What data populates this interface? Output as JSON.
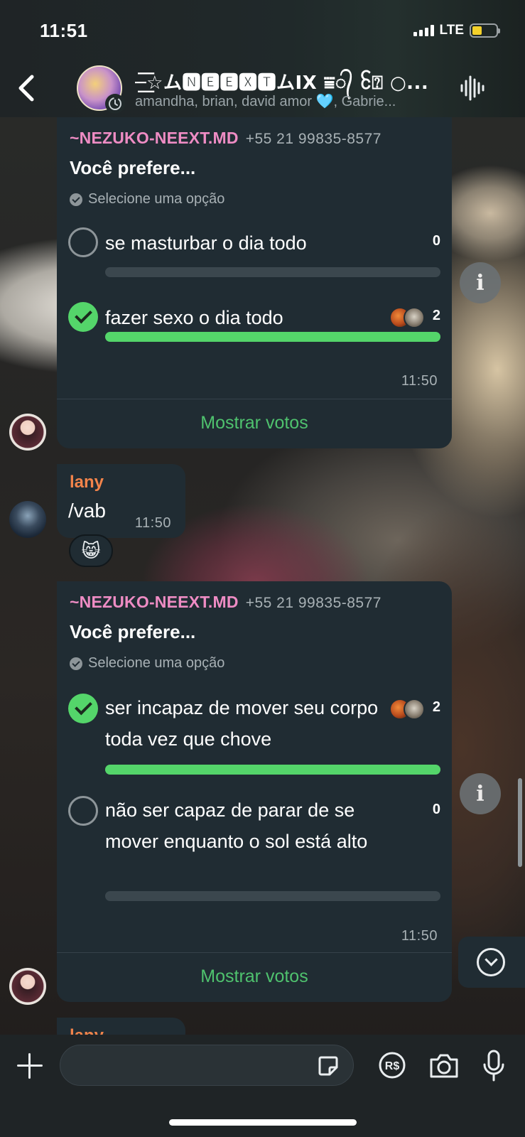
{
  "status_bar": {
    "time": "11:51",
    "network": "LTE"
  },
  "header": {
    "title": "─͟͞☆ム🅽🅴🅴🆇🆃ムIX ⩸᭄ ᩰ⍰ ○...",
    "members": "amandha, brian, david amor 🩵, Gabrie..."
  },
  "polls": [
    {
      "sender": "~NEZUKO-NEEXT.MD",
      "phone": "+55 21 99835-8577",
      "question": "Você prefere...",
      "hint": "Selecione uma opção",
      "options": [
        {
          "text": "se masturbar o dia todo",
          "count": "0",
          "progress": 0
        },
        {
          "text": "fazer sexo o dia todo",
          "count": "2",
          "progress": 1
        }
      ],
      "time": "11:50",
      "show_votes": "Mostrar votos"
    },
    {
      "sender": "~NEZUKO-NEEXT.MD",
      "phone": "+55 21 99835-8577",
      "question": "Você prefere...",
      "hint": "Selecione uma opção",
      "options": [
        {
          "text": "ser incapaz de mover seu corpo toda vez que chove",
          "count": "2",
          "progress": 1
        },
        {
          "text": "não ser capaz de parar de se mover enquanto o sol está alto",
          "count": "0",
          "progress": 0
        }
      ],
      "time": "11:50",
      "show_votes": "Mostrar votos"
    }
  ],
  "text_message": {
    "sender": "lany",
    "text": "/vab",
    "time": "11:50",
    "reaction": "😸"
  },
  "next_sender_partial": "lany",
  "info_label": "i",
  "colors": {
    "accent_green": "#54d56a",
    "link_green": "#4fc26e",
    "sender_pink": "#ee8cc4",
    "sender_orange": "#f2844b",
    "bubble": "#202c33"
  },
  "icons": [
    "back-chevron-icon",
    "voice-waveform-icon",
    "plus-icon",
    "sticker-icon",
    "pix-payment-icon",
    "camera-icon",
    "microphone-icon",
    "info-icon",
    "chevron-down-icon"
  ]
}
